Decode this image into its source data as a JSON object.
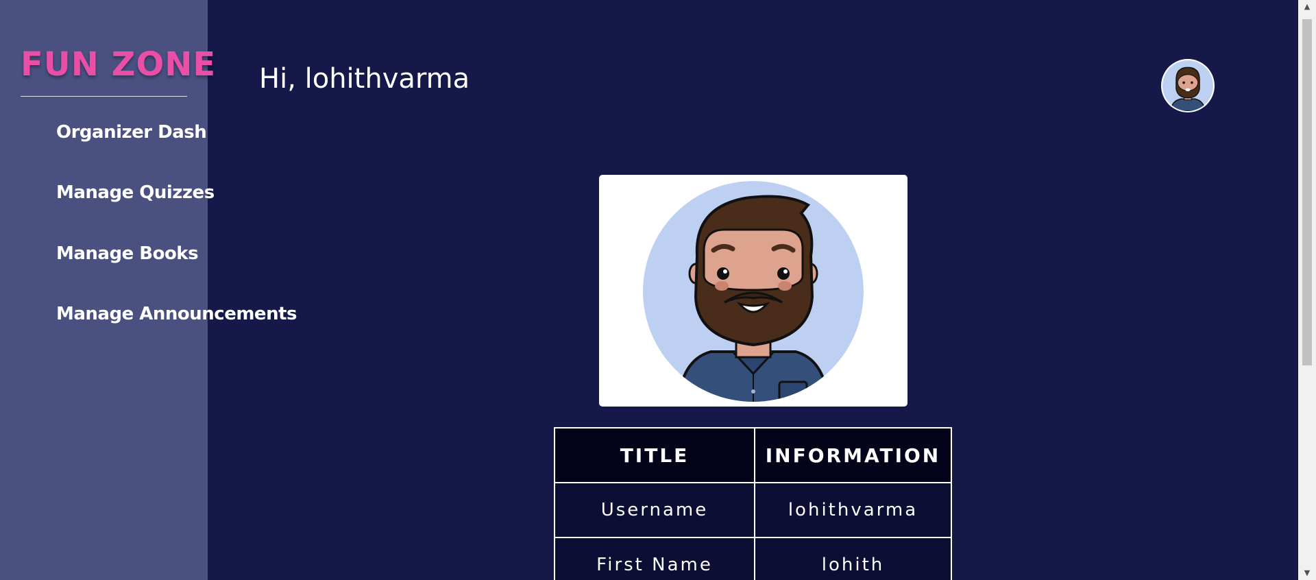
{
  "sidebar": {
    "brand": "FUN ZONE",
    "items": [
      {
        "label": "Organizer Dashboard"
      },
      {
        "label": "Manage Quizzes"
      },
      {
        "label": "Manage Books"
      },
      {
        "label": "Manage Announcements"
      }
    ]
  },
  "header": {
    "greeting": "Hi, lohithvarma"
  },
  "profile": {
    "avatar_icon": "bearded-man-avatar-icon",
    "table": {
      "headers": [
        "TITLE",
        "INFORMATION"
      ],
      "rows": [
        {
          "title": "Username",
          "info": "lohithvarma"
        },
        {
          "title": "First Name",
          "info": "lohith"
        }
      ]
    }
  },
  "colors": {
    "background": "#151848",
    "sidebar": "#4a5080",
    "brand": "#e94fa6"
  }
}
